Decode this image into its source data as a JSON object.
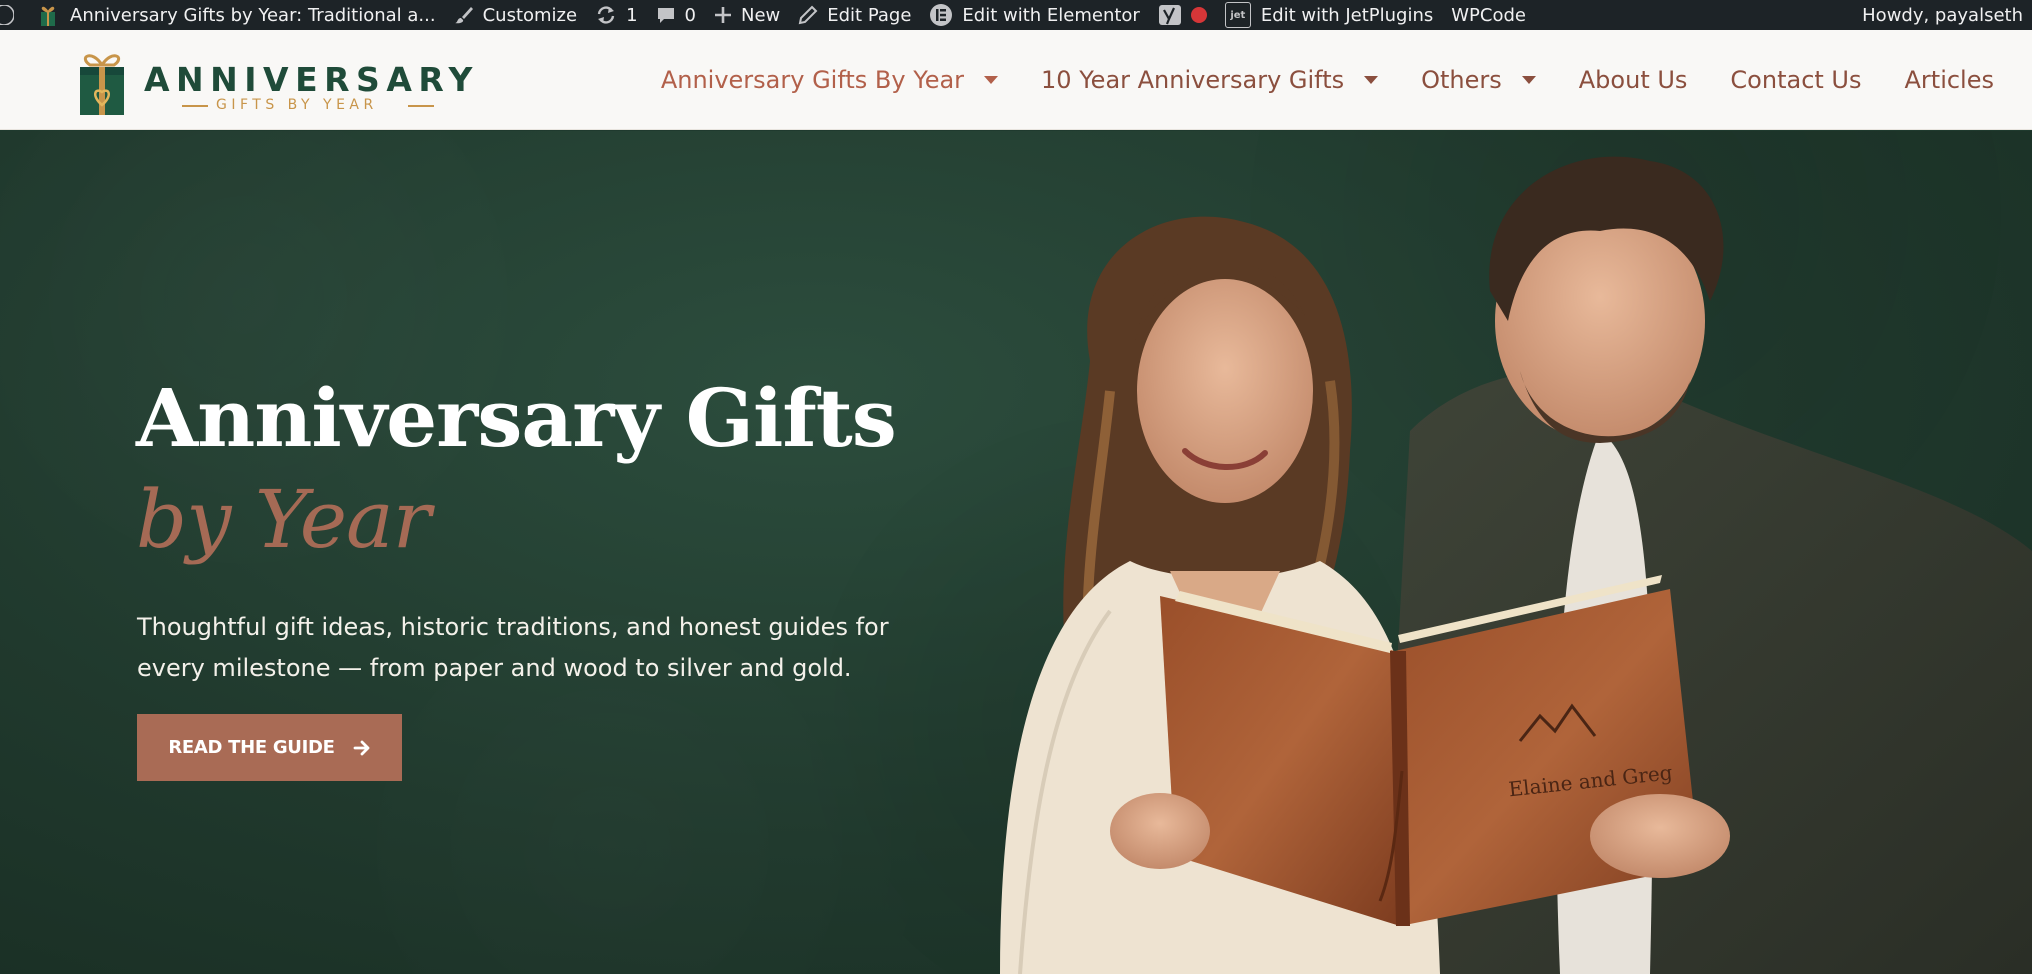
{
  "adminbar": {
    "site_title": "Anniversary Gifts by Year: Traditional a...",
    "customize": "Customize",
    "updates_count": "1",
    "comments_count": "0",
    "new": "New",
    "edit_page": "Edit Page",
    "edit_elementor": "Edit with Elementor",
    "edit_jetplugins": "Edit with JetPlugins",
    "wpcode": "WPCode",
    "howdy": "Howdy, payalseth",
    "yoast_status_color": "#d63638"
  },
  "header": {
    "logo_title": "ANNIVERSARY",
    "logo_subtitle": "GIFTS BY YEAR",
    "nav": [
      {
        "label": "Anniversary Gifts By Year",
        "dropdown": true,
        "active": true
      },
      {
        "label": "10 Year Anniversary Gifts",
        "dropdown": true,
        "active": false
      },
      {
        "label": "Others",
        "dropdown": true,
        "active": false
      },
      {
        "label": "About Us",
        "dropdown": false,
        "active": false
      },
      {
        "label": "Contact Us",
        "dropdown": false,
        "active": false
      },
      {
        "label": "Articles",
        "dropdown": false,
        "active": false
      }
    ]
  },
  "hero": {
    "title": "Anniversary Gifts",
    "title_accent": "by Year",
    "description": "Thoughtful gift ideas, historic traditions, and honest guides for every milestone — from paper and wood to silver and gold.",
    "cta_label": "READ THE GUIDE",
    "book_inscription": "Elaine and Greg"
  },
  "colors": {
    "brand_green": "#1f4b39",
    "accent_terracotta": "#a96b55",
    "nav_text": "#8b4f3e",
    "gold": "#c8954a",
    "adminbar_bg": "#1d2327"
  }
}
